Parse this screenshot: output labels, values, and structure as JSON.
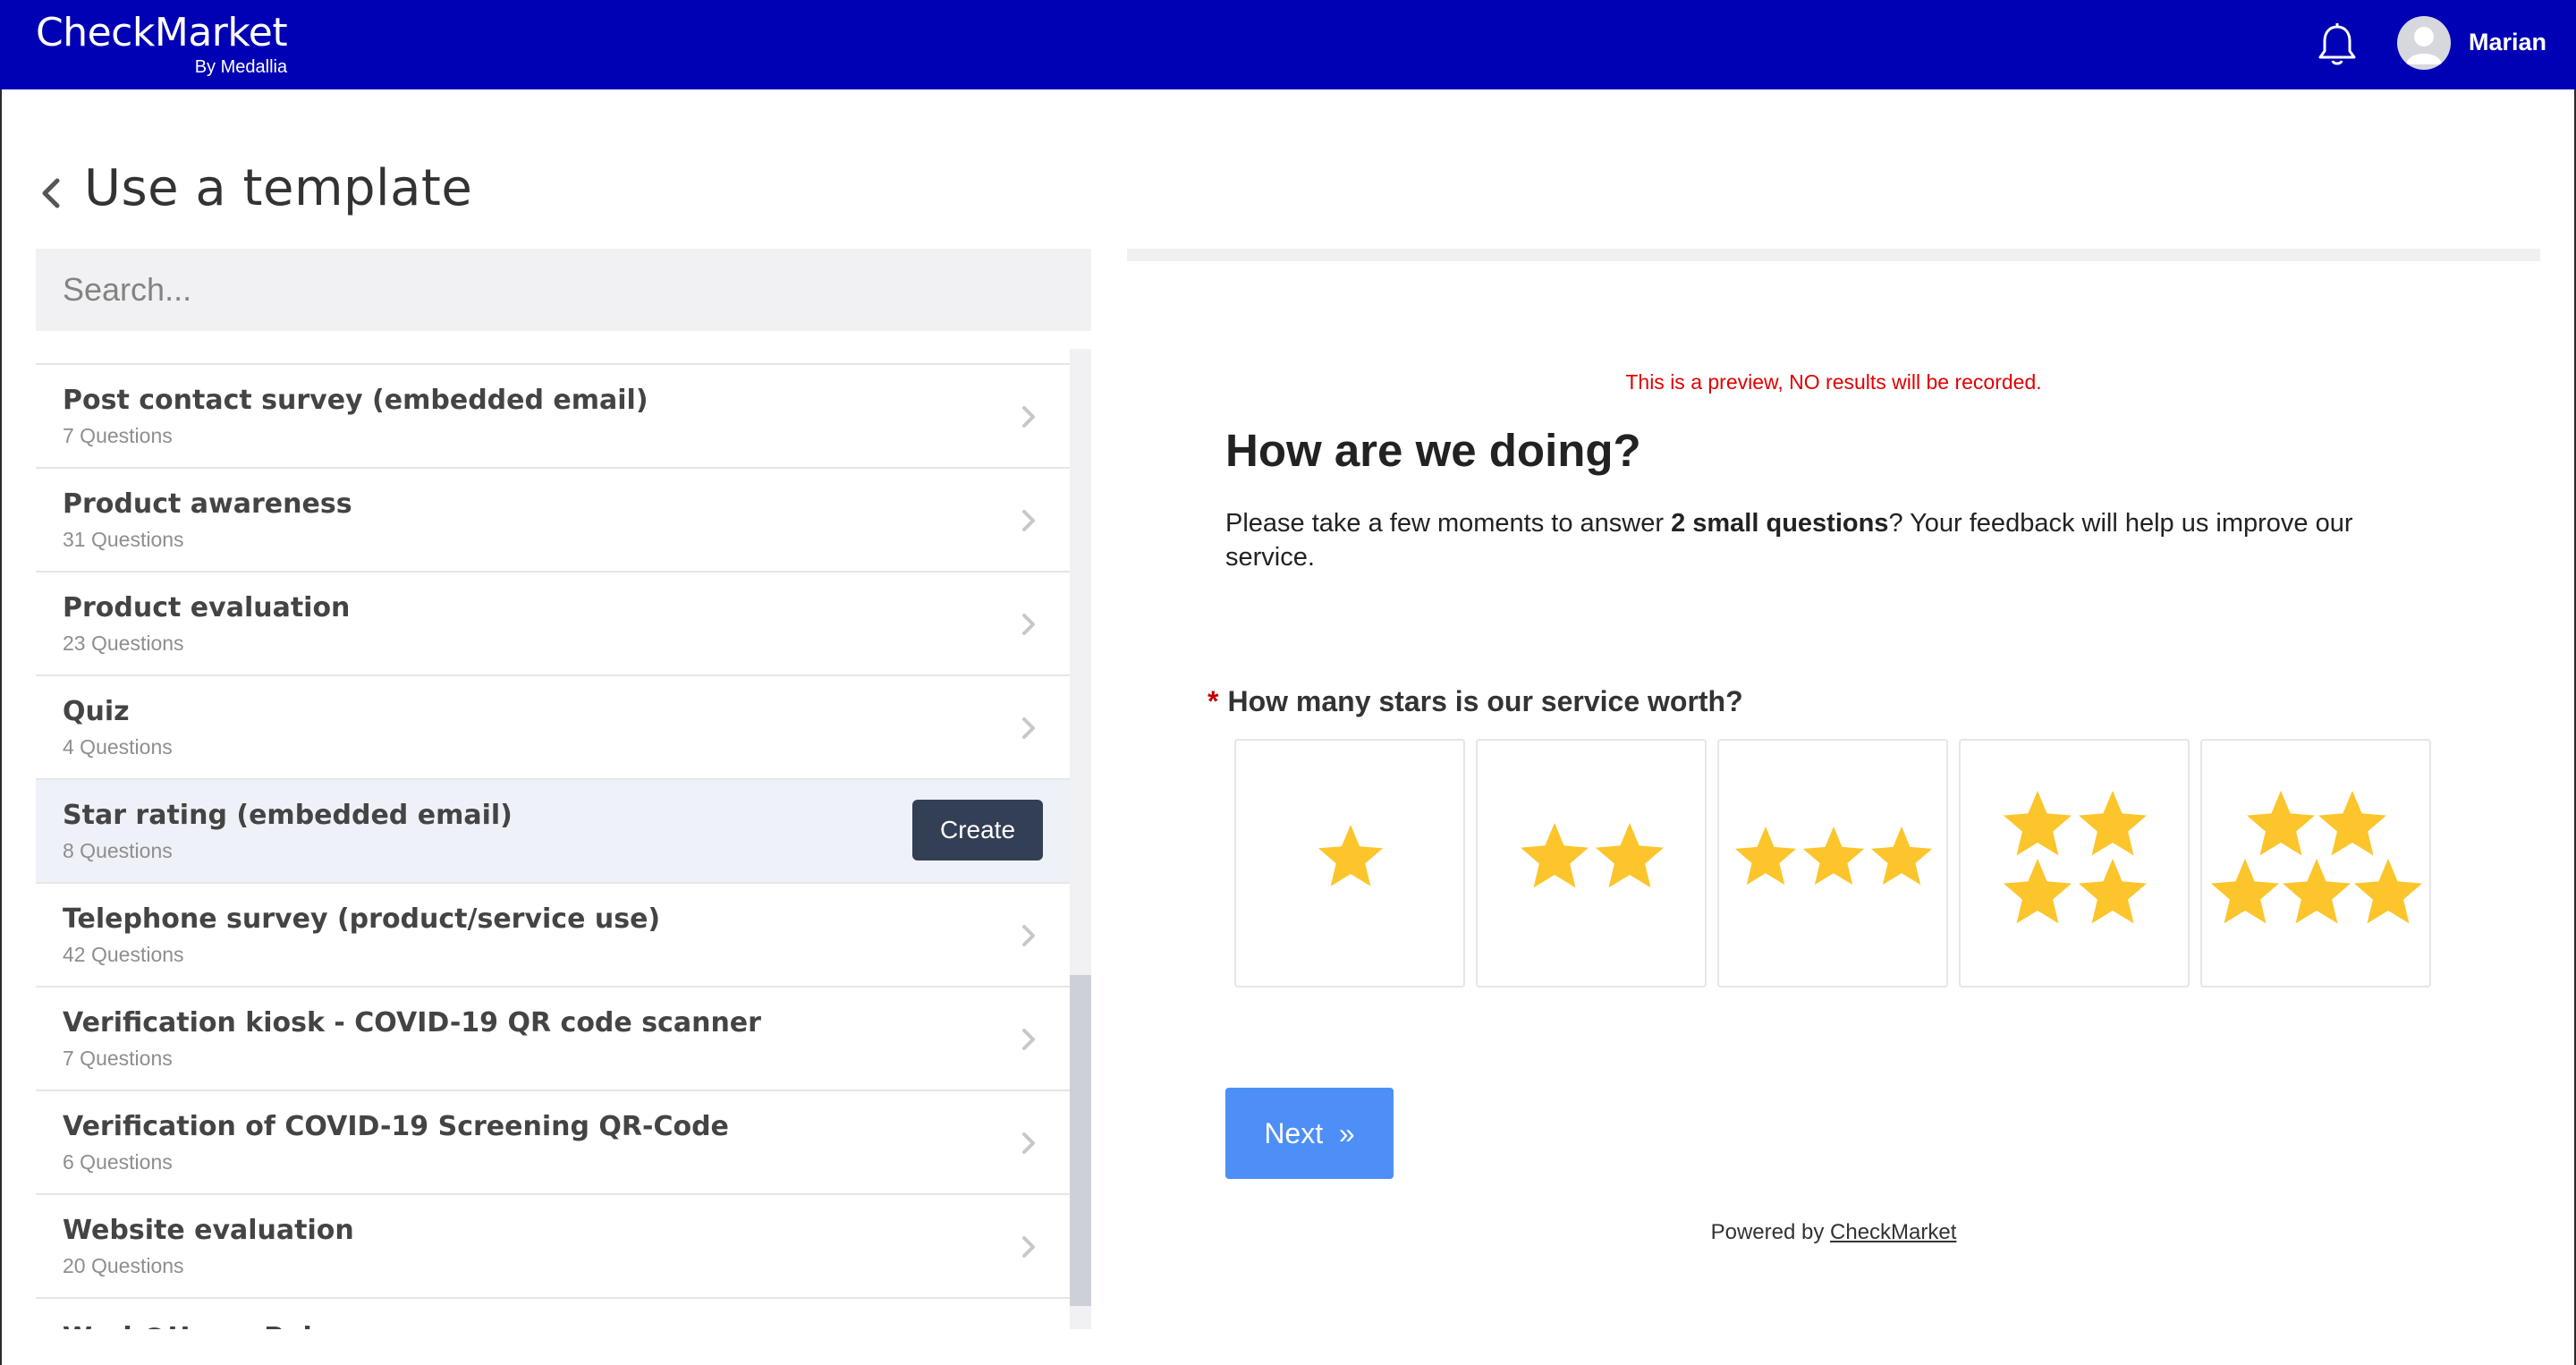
{
  "app": {
    "brand": "CheckMarket",
    "brand_sub": "By Medallia",
    "user_name": "Marian"
  },
  "page": {
    "title": "Use a template",
    "search_placeholder": "Search..."
  },
  "templates": [
    {
      "title": "Post contact survey (embedded email)",
      "subtitle": "7 Questions"
    },
    {
      "title": "Product awareness",
      "subtitle": "31 Questions"
    },
    {
      "title": "Product evaluation",
      "subtitle": "23 Questions"
    },
    {
      "title": "Quiz",
      "subtitle": "4 Questions"
    },
    {
      "title": "Star rating (embedded email)",
      "subtitle": "8 Questions",
      "selected": true,
      "action": "Create"
    },
    {
      "title": "Telephone survey (product/service use)",
      "subtitle": "42 Questions"
    },
    {
      "title": "Verification kiosk - COVID-19 QR code scanner",
      "subtitle": "7 Questions"
    },
    {
      "title": "Verification of COVID-19 Screening QR-Code",
      "subtitle": "6 Questions"
    },
    {
      "title": "Website evaluation",
      "subtitle": "20 Questions"
    }
  ],
  "partial_item": "Work@Home Pulse",
  "preview": {
    "notice": "This is a preview, NO results will be recorded.",
    "title": "How are we doing?",
    "intro_before": "Please take a few moments to answer ",
    "intro_bold": "2 small questions",
    "intro_after": "? Your feedback will help us improve our service.",
    "required_mark": "*",
    "question": "How many stars is our service worth?",
    "ratings": [
      1,
      2,
      3,
      4,
      5
    ],
    "next_label": "Next",
    "next_glyph": "»",
    "powered_prefix": "Powered by ",
    "powered_link": "CheckMarket"
  },
  "colors": {
    "topbar": "#0000b4",
    "star": "#fbc52b",
    "next": "#4d8ff7",
    "create": "#333f55",
    "notice": "#e00000"
  },
  "icons": {
    "bell": "bell-icon",
    "avatar": "user-avatar-icon",
    "back": "chevron-left-icon",
    "row": "chevron-right-icon",
    "star": "star-icon"
  }
}
